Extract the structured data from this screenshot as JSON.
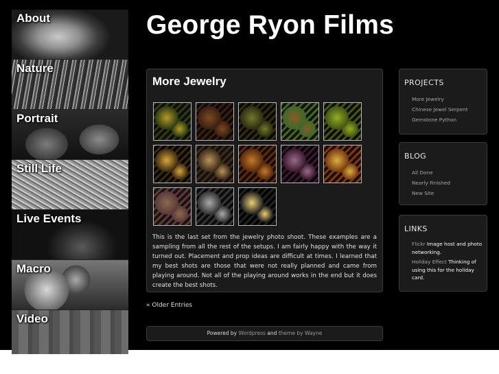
{
  "site": {
    "title": "George Ryon Films"
  },
  "nav": {
    "items": [
      {
        "label": "About",
        "name": "nav-item-about",
        "bg": "bg-about"
      },
      {
        "label": "Nature",
        "name": "nav-item-nature",
        "bg": "bg-nature"
      },
      {
        "label": "Portrait",
        "name": "nav-item-portrait",
        "bg": "bg-portrait"
      },
      {
        "label": "Still Life",
        "name": "nav-item-still-life",
        "bg": "bg-still"
      },
      {
        "label": "Live Events",
        "name": "nav-item-live-events",
        "bg": "bg-live"
      },
      {
        "label": "Macro",
        "name": "nav-item-macro",
        "bg": "bg-macro"
      },
      {
        "label": "Video",
        "name": "nav-item-video",
        "bg": "bg-video"
      }
    ]
  },
  "post": {
    "title": "More Jewelry",
    "thumbnails": [
      {
        "name": "jewelry-thumb-1",
        "colors": [
          "#b39a2a",
          "#2d3b12",
          "#0d0d0d"
        ]
      },
      {
        "name": "jewelry-thumb-2",
        "colors": [
          "#7a4a22",
          "#3a1f10",
          "#0a0a0a"
        ]
      },
      {
        "name": "jewelry-thumb-3",
        "colors": [
          "#6e7a2a",
          "#2f2c10",
          "#080808"
        ]
      },
      {
        "name": "jewelry-thumb-4",
        "colors": [
          "#8a5a26",
          "#3a6a2a",
          "#1a0e08"
        ]
      },
      {
        "name": "jewelry-thumb-5",
        "colors": [
          "#8fae25",
          "#445412",
          "#0b0b0b"
        ]
      },
      {
        "name": "jewelry-thumb-6",
        "colors": [
          "#d8a53a",
          "#3a2a10",
          "#050505"
        ]
      },
      {
        "name": "jewelry-thumb-7",
        "colors": [
          "#b8945a",
          "#3e2a18",
          "#111"
        ]
      },
      {
        "name": "jewelry-thumb-8",
        "colors": [
          "#c07a28",
          "#5a2a0c",
          "#140a04"
        ]
      },
      {
        "name": "jewelry-thumb-9",
        "colors": [
          "#9a6a8a",
          "#3a1a2e",
          "#0a0508"
        ]
      },
      {
        "name": "jewelry-thumb-10",
        "colors": [
          "#d8b040",
          "#7a3a12",
          "#1a0a05"
        ]
      },
      {
        "name": "jewelry-thumb-11",
        "colors": [
          "#8a6a4a",
          "#5a3a3a",
          "#1a120e"
        ]
      },
      {
        "name": "jewelry-thumb-12",
        "colors": [
          "#aaaaaa",
          "#333333",
          "#0a0a0a"
        ]
      },
      {
        "name": "jewelry-thumb-13",
        "colors": [
          "#e8d070",
          "#202020",
          "#020202"
        ]
      }
    ],
    "body": "This is the last set from the jewelry photo shoot. These examples are a sampling from all the rest of the setups. I am fairly happy with the way it turned out. Placement and prop ideas are difficult at times. I learned that my best shots are those that were not really planned and came from playing around. Not all of the playing around works in the end but it does create the best shots."
  },
  "pagination": {
    "older": "« Older Entries"
  },
  "footer": {
    "powered": "Powered by",
    "wordpress": "Wordpress",
    "and": "and",
    "theme": "theme by Wayne"
  },
  "sidebar": {
    "projects": {
      "title": "PROJECTS",
      "items": [
        "More Jewelry",
        "Chinese Jewel Serpent",
        "Gemstone Python"
      ]
    },
    "blog": {
      "title": "BLOG",
      "items": [
        "All Done",
        "Nearly Finished",
        "New Site"
      ]
    },
    "links": {
      "title": "LINKS",
      "items": [
        {
          "link": "Flickr",
          "desc": "Image host and photo networking."
        },
        {
          "link": "Holiday Effect",
          "desc": "Thinking of using this for the holiday card."
        }
      ]
    }
  }
}
